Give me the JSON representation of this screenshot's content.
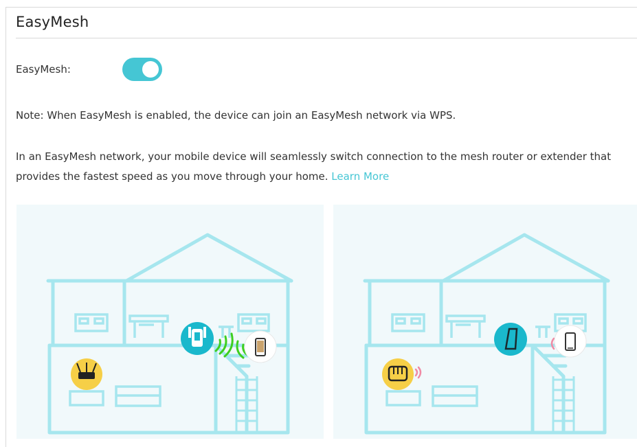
{
  "section": {
    "title": "EasyMesh"
  },
  "easymesh": {
    "label": "EasyMesh:",
    "enabled": true
  },
  "note": "Note: When EasyMesh is enabled, the device can join an EasyMesh network via WPS.",
  "description": {
    "text": "In an EasyMesh network, your mobile device will seamlessly switch connection to the mesh router or extender that provides the fastest speed as you move through your home.",
    "link_label": "Learn More"
  },
  "colors": {
    "accent": "#45c6d4",
    "house_line": "#a6e6ee",
    "router_badge": "#f6cf47",
    "extender_badge": "#1ab8cc",
    "signal_green": "#3ecf1f",
    "signal_pink": "#f08aa4"
  },
  "illustrations": [
    {
      "name": "wps-extender-connection",
      "icons": [
        "router-icon",
        "extender-icon",
        "phone-icon"
      ]
    },
    {
      "name": "mesh-router-connection",
      "icons": [
        "router-icon",
        "extender-icon",
        "phone-icon"
      ]
    }
  ]
}
